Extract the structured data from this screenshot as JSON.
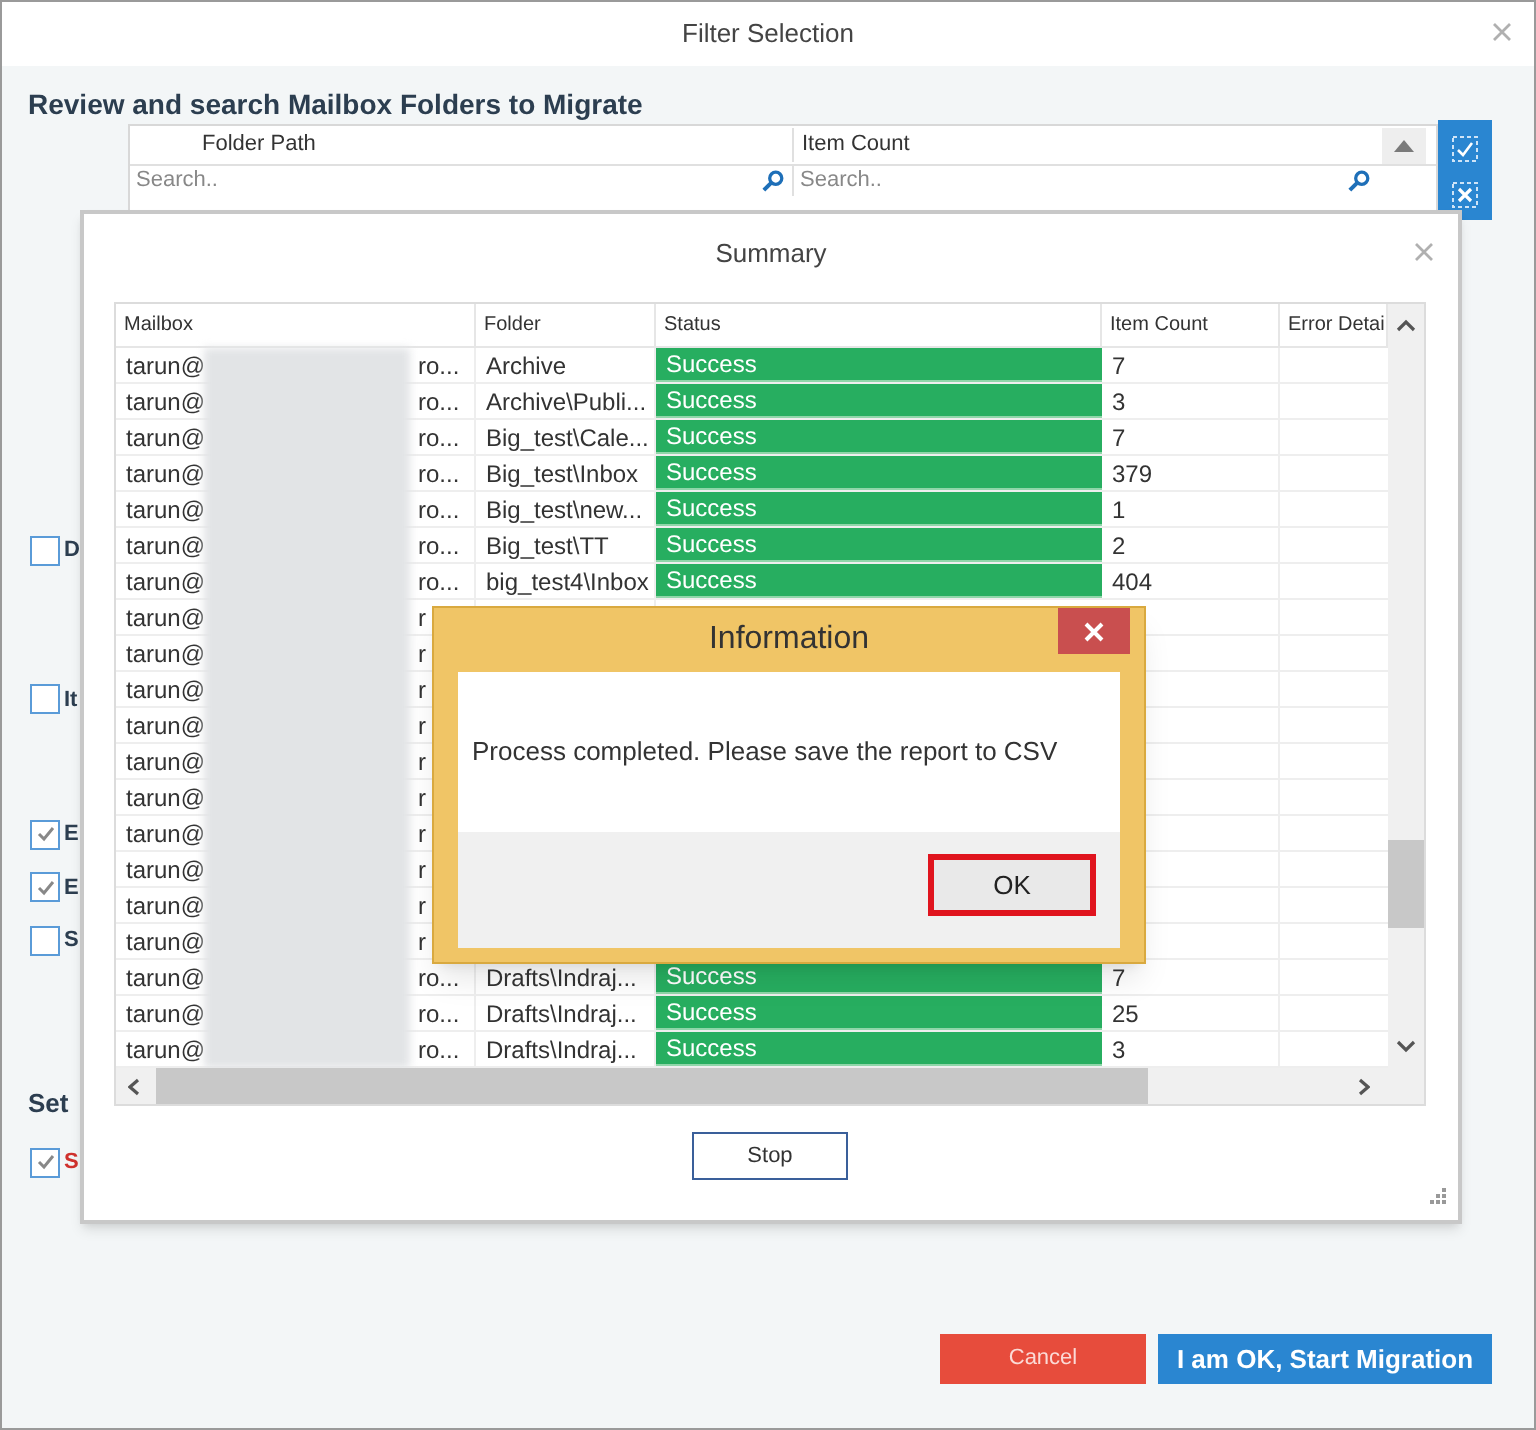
{
  "window": {
    "title": "Filter Selection"
  },
  "heading": "Review and search Mailbox Folders to Migrate",
  "folder_grid": {
    "columns": [
      "Folder Path",
      "Item Count"
    ],
    "search_placeholders": [
      "Search..",
      "Search.."
    ]
  },
  "background_options": [
    {
      "label": "D",
      "checked": false
    },
    {
      "label": "It",
      "checked": false
    },
    {
      "label": "E",
      "checked": true
    },
    {
      "label": "E",
      "checked": true
    },
    {
      "label": "S",
      "checked": false
    }
  ],
  "settings_heading": "Set",
  "settings_option": {
    "label": "S",
    "checked": true
  },
  "summary": {
    "title": "Summary",
    "columns": [
      "Mailbox",
      "Folder",
      "Status",
      "Item Count",
      "Error Detai"
    ],
    "rows": [
      {
        "mailbox_start": "tarun@",
        "mailbox_end": "ro...",
        "folder": "Archive",
        "status": "Success",
        "item_count": "7"
      },
      {
        "mailbox_start": "tarun@",
        "mailbox_end": "ro...",
        "folder": "Archive\\Publi...",
        "status": "Success",
        "item_count": "3"
      },
      {
        "mailbox_start": "tarun@",
        "mailbox_end": "ro...",
        "folder": "Big_test\\Cale...",
        "status": "Success",
        "item_count": "7"
      },
      {
        "mailbox_start": "tarun@",
        "mailbox_end": "ro...",
        "folder": "Big_test\\Inbox",
        "status": "Success",
        "item_count": "379"
      },
      {
        "mailbox_start": "tarun@",
        "mailbox_end": "ro...",
        "folder": "Big_test\\new...",
        "status": "Success",
        "item_count": "1"
      },
      {
        "mailbox_start": "tarun@",
        "mailbox_end": "ro...",
        "folder": "Big_test\\TT",
        "status": "Success",
        "item_count": "2"
      },
      {
        "mailbox_start": "tarun@",
        "mailbox_end": "ro...",
        "folder": "big_test4\\Inbox",
        "status": "Success",
        "item_count": "404"
      },
      {
        "mailbox_start": "tarun@",
        "mailbox_end": "r"
      },
      {
        "mailbox_start": "tarun@",
        "mailbox_end": "r"
      },
      {
        "mailbox_start": "tarun@",
        "mailbox_end": "r"
      },
      {
        "mailbox_start": "tarun@",
        "mailbox_end": "r"
      },
      {
        "mailbox_start": "tarun@",
        "mailbox_end": "r"
      },
      {
        "mailbox_start": "tarun@",
        "mailbox_end": "r"
      },
      {
        "mailbox_start": "tarun@",
        "mailbox_end": "r"
      },
      {
        "mailbox_start": "tarun@",
        "mailbox_end": "r"
      },
      {
        "mailbox_start": "tarun@",
        "mailbox_end": "r"
      },
      {
        "mailbox_start": "tarun@",
        "mailbox_end": "r"
      },
      {
        "mailbox_start": "tarun@",
        "mailbox_end": "ro...",
        "folder": "Drafts\\Indraj...",
        "status": "Success",
        "item_count": "7"
      },
      {
        "mailbox_start": "tarun@",
        "mailbox_end": "ro...",
        "folder": "Drafts\\Indraj...",
        "status": "Success",
        "item_count": "25"
      },
      {
        "mailbox_start": "tarun@",
        "mailbox_end": "ro...",
        "folder": "Drafts\\Indraj...",
        "status": "Success",
        "item_count": "3"
      }
    ],
    "stop_button": "Stop"
  },
  "information": {
    "title": "Information",
    "message": "Process completed. Please save the report to CSV",
    "ok_button": "OK"
  },
  "buttons": [
    {
      "label": "Cancel",
      "kind": "cancel"
    },
    {
      "label": "I am OK, Start Migration",
      "kind": "primary"
    }
  ]
}
